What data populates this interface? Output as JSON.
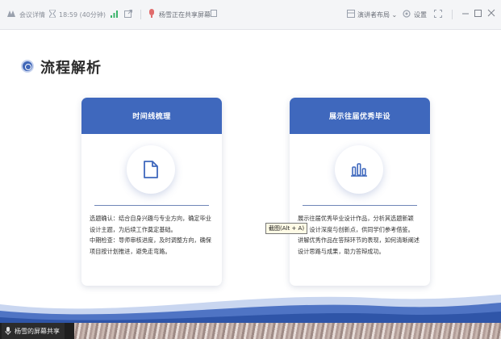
{
  "toolbar": {
    "meeting_info": "会议详情",
    "timer": "18:59 (40分钟)",
    "share_status": "杨雪正在共享屏幕",
    "layout_label": "演讲者布局",
    "settings_label": "设置"
  },
  "slide": {
    "title": "流程解析",
    "cards": [
      {
        "header": "时间线梳理",
        "icon": "document-icon",
        "paragraphs": [
          "选题确认：结合自身兴趣与专业方向，确定毕业设计主题，为后续工作奠定基础。",
          "中期检查：导师审核进度，及时调整方向，确保项目按计划推进，避免走弯路。"
        ]
      },
      {
        "header": "展示往届优秀毕设",
        "icon": "bar-chart-icon",
        "paragraphs": [
          "展示往届优秀毕业设计作品，分析其选题新颖性、设计深度与创新点，供同学们参考借鉴。",
          "讲解优秀作品在答辩环节的表现，如何清晰阐述设计思路与成果，助力答辩成功。"
        ]
      }
    ]
  },
  "tooltip": "截图(Alt + A)",
  "bottom": {
    "share_tag": "杨雪的屏幕共享"
  },
  "colors": {
    "accent": "#3f68bd",
    "bottom_bar": "#1f1f1f"
  }
}
